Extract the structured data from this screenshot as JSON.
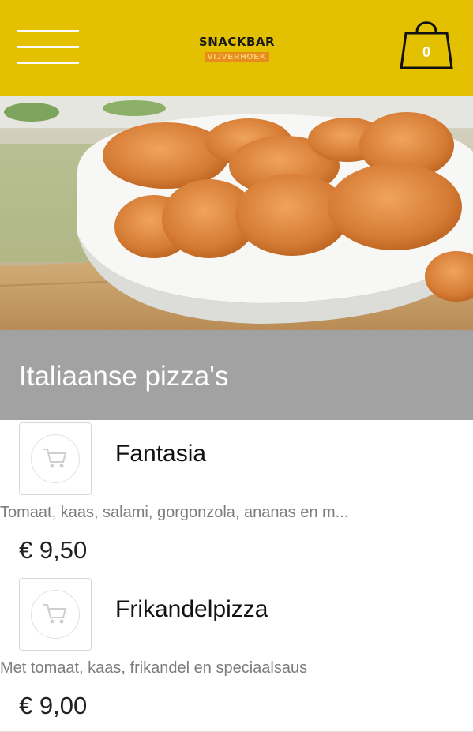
{
  "header": {
    "brand_top": "SNACKBAR",
    "brand_bottom": "VIJVERHOEK",
    "cart_count": "0",
    "colors": {
      "background": "#e3c100",
      "icon": "#111111"
    }
  },
  "hero": {
    "image": "chicken-nuggets-in-bowl"
  },
  "category": {
    "title": "Italiaanse pizza's"
  },
  "products": [
    {
      "name": "Fantasia",
      "description": "Tomaat, kaas, salami, gorgonzola, ananas en m...",
      "price": "€ 9,50",
      "icon": "add-to-cart-icon"
    },
    {
      "name": "Frikandelpizza",
      "description": "Met tomaat, kaas, frikandel en speciaalsaus",
      "price": "€ 9,00",
      "icon": "add-to-cart-icon"
    }
  ]
}
